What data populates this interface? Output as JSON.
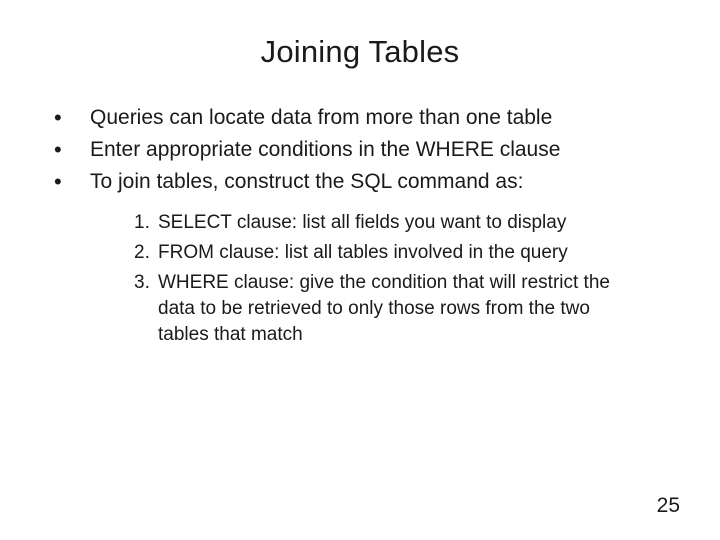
{
  "title": "Joining Tables",
  "bullets": [
    {
      "text": "Queries can locate data from more than one table"
    },
    {
      "text": "Enter appropriate conditions in the WHERE clause"
    },
    {
      "text": "To join tables, construct the SQL command as:"
    }
  ],
  "numbered": [
    {
      "label": "1.",
      "text": "SELECT clause: list all fields you want to display"
    },
    {
      "label": "2.",
      "text": "FROM clause: list all tables involved in the query"
    },
    {
      "label": "3.",
      "text": "WHERE clause: give the condition that will restrict the data to be retrieved to only those rows from the two tables that match"
    }
  ],
  "page_number": "25",
  "bullet_glyph": "•"
}
